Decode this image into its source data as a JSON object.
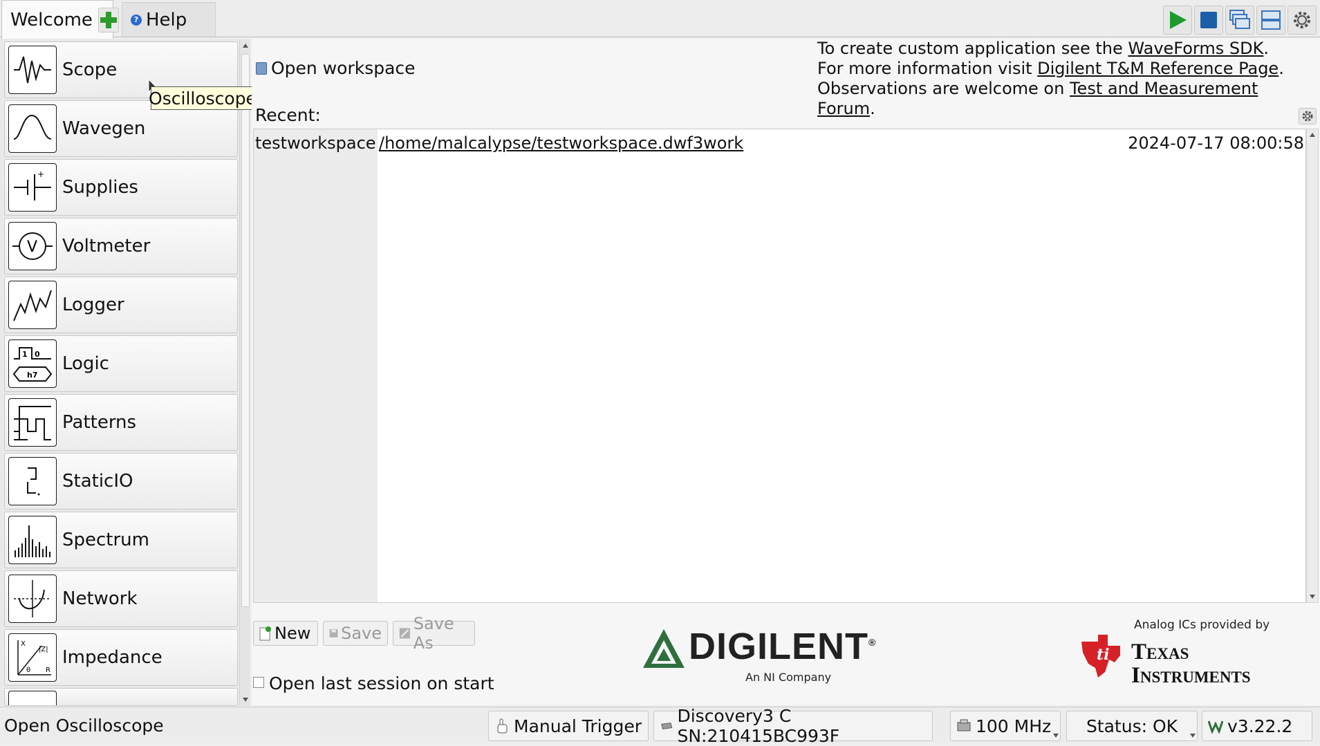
{
  "tabs": {
    "welcome": "Welcome",
    "help": "Help",
    "help_badge": "?"
  },
  "instruments": [
    {
      "label": "Scope",
      "icon": "scope-wave-icon"
    },
    {
      "label": "Wavegen",
      "icon": "sine-wave-icon"
    },
    {
      "label": "Supplies",
      "icon": "supply-symbol-icon"
    },
    {
      "label": "Voltmeter",
      "icon": "voltmeter-icon"
    },
    {
      "label": "Logger",
      "icon": "logger-trace-icon"
    },
    {
      "label": "Logic",
      "icon": "logic-icon"
    },
    {
      "label": "Patterns",
      "icon": "pattern-pulse-icon"
    },
    {
      "label": "StaticIO",
      "icon": "static-io-icon"
    },
    {
      "label": "Spectrum",
      "icon": "spectrum-bars-icon"
    },
    {
      "label": "Network",
      "icon": "network-bode-icon"
    },
    {
      "label": "Impedance",
      "icon": "impedance-icon"
    }
  ],
  "instrument_icon_text": {
    "supplies_plus": "+",
    "voltmeter_v": "V",
    "logic_top": "1",
    "logic_top2": "0",
    "logic_bottom": "h7",
    "impedance_x": "X",
    "impedance_z": "|Z|",
    "impedance_theta": "θ",
    "impedance_r": "R"
  },
  "tooltip": "Oscilloscope",
  "main": {
    "open_workspace": "Open workspace",
    "info_line1_prefix": "To create custom application see the ",
    "info_line1_link": "WaveForms SDK",
    "info_line1_suffix": ".",
    "info_line2_prefix": "For more information visit ",
    "info_line2_link": "Digilent T&M Reference Page",
    "info_line2_suffix": ".",
    "info_line3_prefix": "Observations are welcome on ",
    "info_line3_link": "Test and Measurement Forum",
    "info_line3_suffix": ".",
    "recent_label": "Recent:",
    "recent": [
      {
        "name": "testworkspace",
        "path": "/home/malcalypse/testworkspace.dwf3work",
        "date": "2024-07-17 08:00:58"
      }
    ],
    "buttons": {
      "new": "New",
      "save": "Save",
      "save_as": "Save As"
    },
    "open_last_session": "Open last session on start",
    "open_last_session_checked": false
  },
  "logos": {
    "digilent": "DIGILENT",
    "digilent_reg": "®",
    "digilent_sub": "An NI Company",
    "ti_pre": "Analog ICs provided by",
    "ti_line1": "Texas",
    "ti_line2": "Instruments"
  },
  "statusbar": {
    "left": "Open Oscilloscope",
    "trigger": "Manual Trigger",
    "device": "Discovery3 C SN:210415BC993F",
    "frequency": "100 MHz",
    "status": "Status: OK",
    "version": "v3.22.2"
  },
  "colors": {
    "run_green": "#1f9a2e",
    "stop_blue": "#1b5fa8",
    "digilent_green": "#2f6f3e",
    "ti_red": "#d62027"
  }
}
